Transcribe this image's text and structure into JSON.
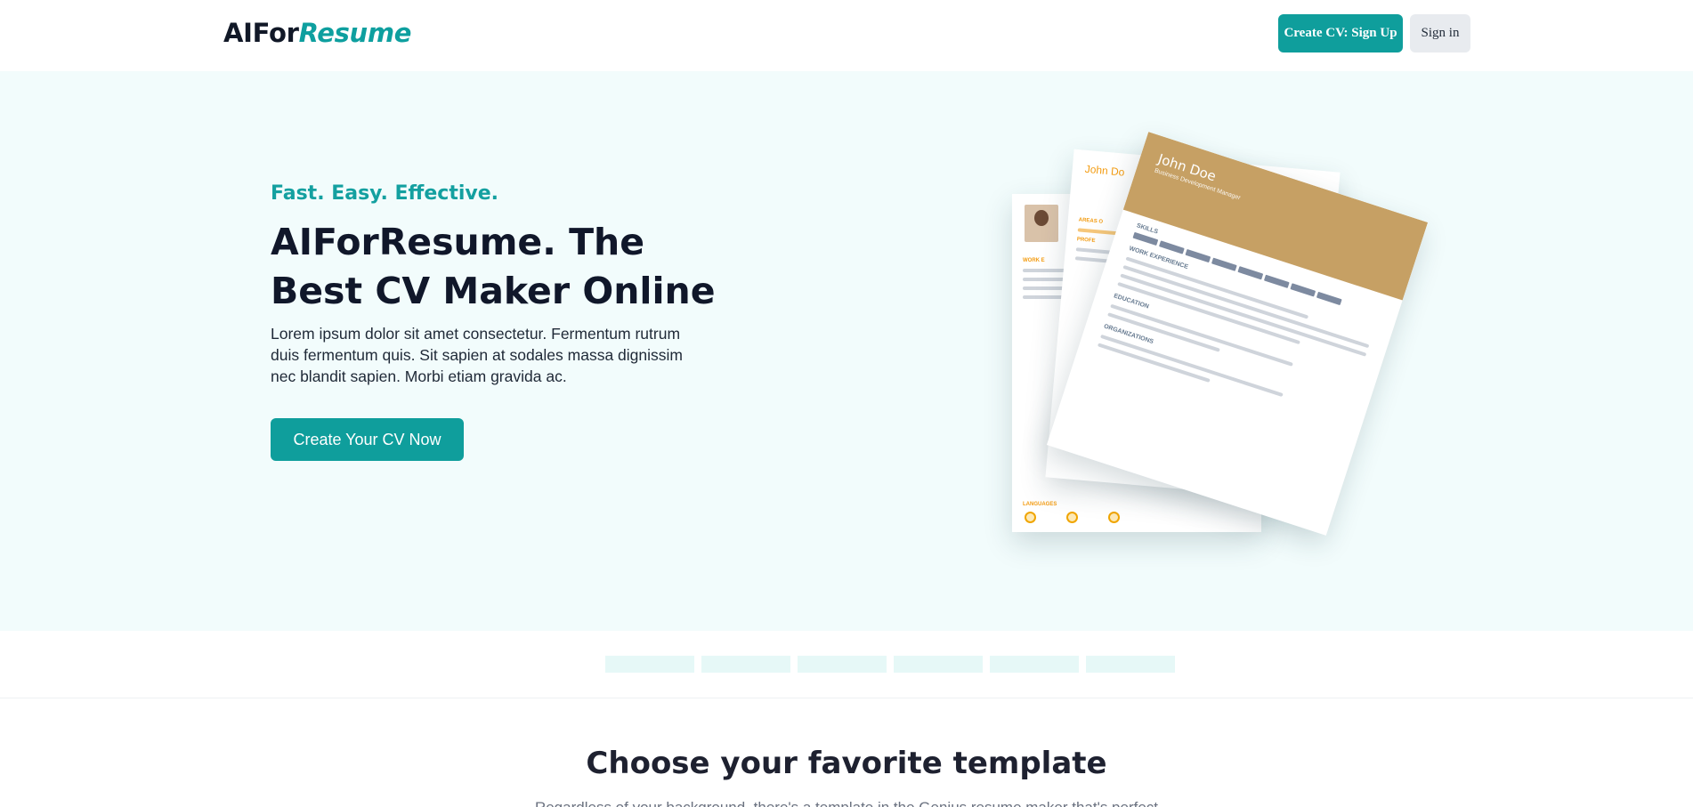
{
  "header": {
    "logo_prefix": "AIFor",
    "logo_accent": "Resume",
    "signup_label": "Create CV: Sign Up",
    "signin_label": "Sign in"
  },
  "hero": {
    "tagline": "Fast. Easy. Effective.",
    "title": "AIForResume. The Best CV Maker Online",
    "description": "Lorem ipsum dolor sit amet consectetur. Fermentum rutrum duis fermentum quis. Sit sapien at sodales massa dignissim nec blandit sapien. Morbi etiam gravida ac.",
    "cta_label": "Create Your CV Now"
  },
  "illustration": {
    "front_name": "John Doe",
    "front_role": "Business Development Manager",
    "section_skills": "SKILLS",
    "section_work": "WORK EXPERIENCE",
    "section_education": "EDUCATION",
    "section_organizations": "ORGANIZATIONS",
    "mid_name": "John Do",
    "back_section_work": "WORK E",
    "back_section_languages": "LANGUAGES",
    "mid_section_areas": "AREAS O",
    "mid_section_prof": "PROFE",
    "accent_color": "#c6a064",
    "secondary_accent": "#f39c12"
  },
  "templates": {
    "title": "Choose your favorite template",
    "subtitle": "Regardless of your background, there's a template in the Genius resume maker that's perfect"
  },
  "colors": {
    "brand": "#0f9e9c",
    "hero_bg": "#f2fcfc"
  }
}
